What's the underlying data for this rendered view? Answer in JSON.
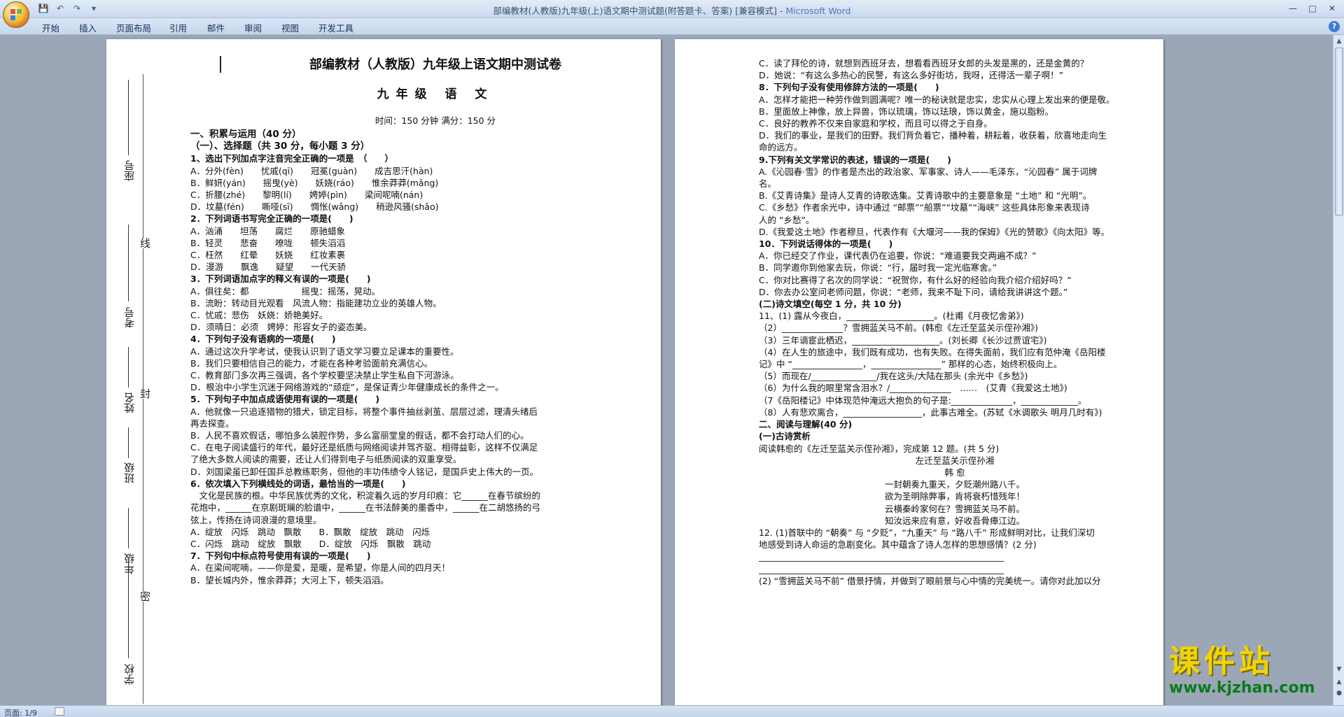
{
  "window": {
    "title_prefix": "部编教材(人教版)九年级(上)语文期中测试题(附答题卡、答案) [兼容模式] - ",
    "title_app": "Microsoft Word"
  },
  "ribbon_tabs": [
    "开始",
    "插入",
    "页面布局",
    "引用",
    "邮件",
    "审阅",
    "视图",
    "开发工具"
  ],
  "status": {
    "page": "页面: 1/9"
  },
  "watermark": {
    "text": "课件站",
    "url": "www.kjzhan.com"
  },
  "page1": {
    "title": "部编教材（人教版）九年级上语文期中测试卷",
    "subtitle": "九年级    语    文",
    "time_line": "时间：150 分钟    满分：150 分",
    "binding_fields": [
      "学校",
      "年级",
      "班级",
      "姓名",
      "考号",
      "座号"
    ],
    "binding_words": [
      "密",
      "封",
      "线"
    ],
    "lines": [
      {
        "t": "一、积累与运用（40 分）",
        "s": "h"
      },
      {
        "t": "（一）、选择题（共 30 分，每小题 3 分）",
        "s": "h"
      },
      {
        "t": "1、选出下列加点字注音完全正确的一项是　（　　）",
        "s": "b"
      },
      {
        "t": "A．分外(fèn)　　忧戚(qī)　　冠冕(guàn)　　成吉思汗(hàn)"
      },
      {
        "t": "B．鲜妍(yán)　　摇曳(yè)　　妖娆(ráo)　　惟余莽莽(mǎng)"
      },
      {
        "t": "C．折腰(zhé)　　黎明(lí)　　娉婷(pìn)　　梁间呢喃(nán)"
      },
      {
        "t": "D．坟墓(fén)　　嘶哑(sī)　　惆怅(wǎng)　　稍逊风骚(shǎo)"
      },
      {
        "t": "2．下列词语书写完全正确的一项是(　　)",
        "s": "b"
      },
      {
        "t": "A．汹涌　　坦荡　　腐烂　　原驰蜡象"
      },
      {
        "t": "B．轻灵　　悲奋　　嘹咙　　顿失滔滔"
      },
      {
        "t": "C．枉然　　红晕　　妖娆　　红妆素裹"
      },
      {
        "t": "D．漫游　　飘逸　　疑望　　一代天骄"
      },
      {
        "t": "3．下列词语加点字的释义有误的一项是(　　)",
        "s": "b"
      },
      {
        "t": "A．俱往矣：都　　　　　　摇曳：摇荡，晃动。"
      },
      {
        "t": "B．流盼：转动目光观看　风流人物：指能建功立业的英雄人物。"
      },
      {
        "t": "C．忧戚：悲伤　妖娆：娇艳美好。"
      },
      {
        "t": "D．须晴日：必须　娉婷：形容女子的姿态美。"
      },
      {
        "t": "4．下列句子没有语病的一项是(　　)",
        "s": "b"
      },
      {
        "t": "A．通过这次升学考试，使我认识到了语文学习要立足课本的重要性。"
      },
      {
        "t": "B．我们只要相信自己的能力，才能在各种考验面前充满信心。"
      },
      {
        "t": "C．教育部门多次再三强调，各个学校要坚决禁止学生私自下河游泳。"
      },
      {
        "t": "D．根治中小学生沉迷于网络游戏的“顽症”，是保证青少年健康成长的条件之一。"
      },
      {
        "t": "5．下列句子中加点成语使用有误的一项是(　　)",
        "s": "b"
      },
      {
        "t": "A．他就像一只追逐猎物的猎犬，锁定目标，将整个事件抽丝剥茧、层层过滤，理清头绪后"
      },
      {
        "t": "再去探查。"
      },
      {
        "t": "B．人民不喜欢假话，哪怕多么装腔作势，多么富丽堂皇的假话，都不会打动人们的心。"
      },
      {
        "t": "C．在电子阅读盛行的年代，最好还是纸质与网络阅读并驾齐驱、相得益彰，这样不仅满足"
      },
      {
        "t": "了绝大多数人阅读的需要，还让人们得到电子与纸质阅读的双重享受。"
      },
      {
        "t": "D．刘国梁虽已卸任国乒总教练职务，但他的丰功伟绩令人铭记，是国乒史上伟大的一页。"
      },
      {
        "t": "6．依次填入下列横线处的词语，最恰当的一项是(　　)",
        "s": "b"
      },
      {
        "t": "　文化是民族的根。中华民族优秀的文化，积淀着久远的岁月印痕：它______在春节缤纷的"
      },
      {
        "t": "花炮中，______在京剧斑斓的脸谱中，______在书法醉美的墨香中，______在二胡悠扬的弓"
      },
      {
        "t": "弦上，传扬在诗词浪漫的意境里。"
      },
      {
        "t": "A．绽放　闪烁　跳动　飘散　　B．飘散　绽放　跳动　闪烁"
      },
      {
        "t": "C．闪烁　跳动　绽放　飘散　　D．绽放　闪烁　飘散　跳动"
      },
      {
        "t": "7．下列句中标点符号使用有误的一项是(　　)",
        "s": "b"
      },
      {
        "t": "A．在梁间呢喃，——你是爱，是暖，是希望，你是人间的四月天！"
      },
      {
        "t": "B．望长城内外，惟余莽莽；大河上下，顿失滔滔。"
      }
    ]
  },
  "page2": {
    "lines": [
      {
        "t": "C．读了拜伦的诗，就想到西班牙去，想看看西班牙女郎的头发是黑的，还是金黄的？"
      },
      {
        "t": "D．她说：“有这么多热心的民警，有这么多好街坊，我呀，还得活一辈子啊！”"
      },
      {
        "t": "8．下列句子没有使用修辞方法的一项是(　　)",
        "s": "b"
      },
      {
        "t": "A．怎样才能把一种劳作做到圆满呢？唯一的秘诀就是忠实，忠实从心理上发出来的便是敬。"
      },
      {
        "t": "B．里面放上神像，放上异兽，饰以琉璃，饰以珐琅，饰以黄金，施以脂粉。"
      },
      {
        "t": "C．良好的教养不仅来自家庭和学校，而且可以得之于自身。"
      },
      {
        "t": "D．我们的事业，是我们的田野。我们背负着它，播种着，耕耘着，收获着，欣喜地走向生"
      },
      {
        "t": "命的远方。"
      },
      {
        "t": "9.下列有关文学常识的表述，错误的一项是(　　)",
        "s": "b"
      },
      {
        "t": "A.《沁园春·雪》的作者是杰出的政治家、军事家、诗人——毛泽东，“沁园春” 属于词牌"
      },
      {
        "t": "名。"
      },
      {
        "t": "B.《艾青诗集》是诗人艾青的诗歌选集。艾青诗歌中的主要意象是 “土地” 和 “光明”。"
      },
      {
        "t": "C.《乡愁》作者余光中，诗中通过 “邮票”“船票”“坟墓”“海峡” 这些具体形象来表现诗"
      },
      {
        "t": "人的 “乡愁”。"
      },
      {
        "t": "D.《我爱这土地》作者穆旦，代表作有《大堰河——我的保姆》《光的赞歌》《向太阳》等。"
      },
      {
        "t": "10．下列说话得体的一项是(　　)",
        "s": "b"
      },
      {
        "t": "A．你已经交了作业，课代表仍在追要，你说：“难道要我交两遍不成？”"
      },
      {
        "t": "B．同学邀你到他家去玩，你说：“行，届时我一定光临寒舍。”"
      },
      {
        "t": "C．你对比赛得了名次的同学说：“祝贺你，有什么好的经验向我介绍介绍好吗？”"
      },
      {
        "t": "D．你去办公室问老师问题，你说：“老师，我来不耻下问，请给我讲讲这个题。”"
      },
      {
        "t": "(二)诗文填空(每空 1 分，共 10 分)",
        "s": "b"
      },
      {
        "t": "11、(1) 露从今夜白，____________________。(杜甫《月夜忆舍弟》)"
      },
      {
        "t": "（2）______________？雪拥蓝关马不前。(韩愈《左迁至蓝关示侄孙湘》)"
      },
      {
        "t": "（3）三年谪宦此栖迟，____________________。(刘长卿《长沙过贾谊宅》)"
      },
      {
        "t": "（4）在人生的旅途中，我们既有成功，也有失败。在得失面前，我们应有范仲淹《岳阳楼"
      },
      {
        "t": "记》中 “________________，________________” 那样的心态，始终积极向上。"
      },
      {
        "t": "（5）而现在/_______________/我在这头/大陆在那头 (余光中《乡愁》)"
      },
      {
        "t": "（6）为什么我的眼里常含泪水？/______________　……　(艾青《我爱这土地》)"
      },
      {
        "t": "（7《岳阳楼记》中体现范仲淹远大抱负的句子是:______________，_____________。"
      },
      {
        "t": "（8）人有悲欢离合，__________________，此事古难全。(苏轼《水调歌头 明月几时有》)"
      },
      {
        "t": "二、阅读与理解(40 分)",
        "s": "b"
      },
      {
        "t": "(一)古诗赏析",
        "s": "b"
      },
      {
        "t": "阅读韩愈的《左迁至蓝关示侄孙湘》，完成第 12 题。(共 5 分)"
      },
      {
        "t": "左迁至蓝关示侄孙湘",
        "s": "c"
      },
      {
        "t": "韩 愈",
        "s": "c"
      },
      {
        "t": "一封朝奏九重天，夕贬潮州路八千。",
        "s": "c"
      },
      {
        "t": "欲为圣明除弊事，肯将衰朽惜残年！",
        "s": "c"
      },
      {
        "t": "云横秦岭家何在？雪拥蓝关马不前。",
        "s": "c"
      },
      {
        "t": "知汝远来应有意，好收吾骨瘴江边。",
        "s": "c"
      },
      {
        "t": "12. (1)首联中的 “朝奏” 与 “夕贬”，“九重天” 与 “路八千” 形成鲜明对比，让我们深切"
      },
      {
        "t": "地感受到诗人命运的急剧变化。其中蕴含了诗人怎样的思想感情？(2 分)"
      },
      {
        "t": "________________________________________________________"
      },
      {
        "t": "________________________________________________________"
      },
      {
        "t": "(2) “雪拥蓝关马不前” 借景抒情，并做到了眼前景与心中情的完美统一。请你对此加以分"
      }
    ]
  }
}
